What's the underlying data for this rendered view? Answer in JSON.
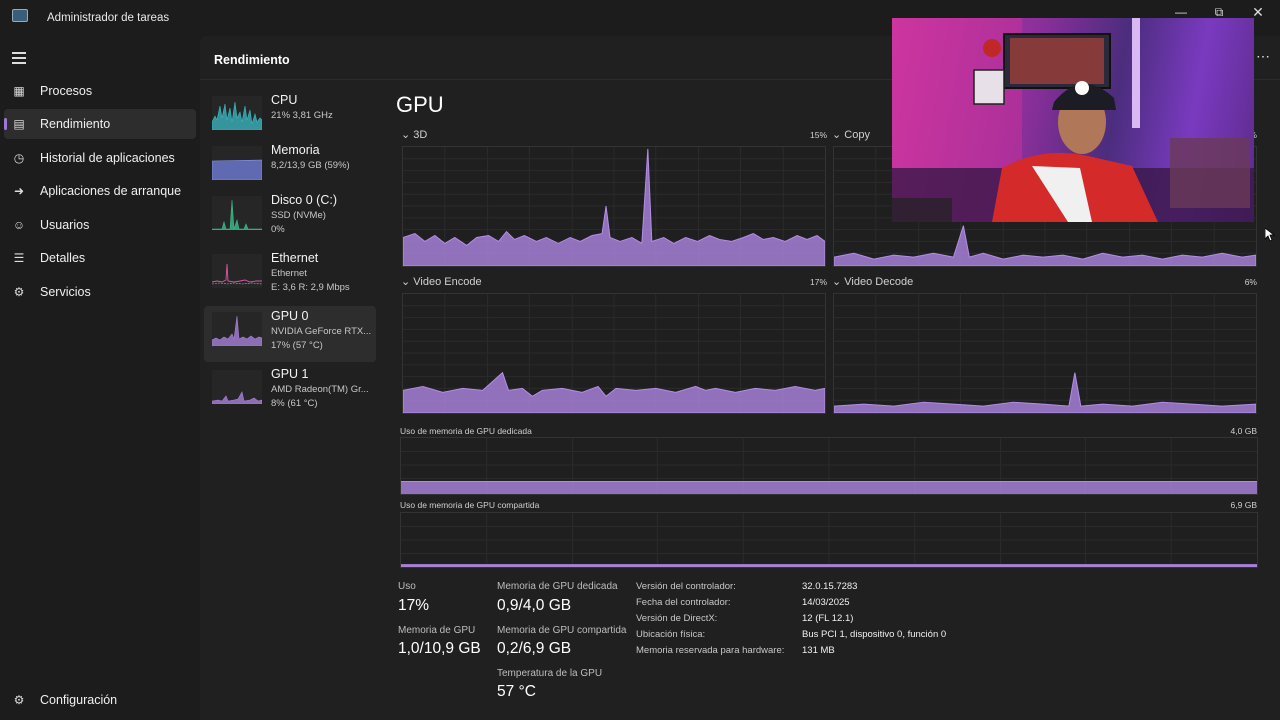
{
  "window": {
    "title": "Administrador de tareas"
  },
  "nav": {
    "items": [
      {
        "label": "Procesos",
        "icon": "processes-icon"
      },
      {
        "label": "Rendimiento",
        "icon": "performance-icon"
      },
      {
        "label": "Historial de aplicaciones",
        "icon": "history-icon"
      },
      {
        "label": "Aplicaciones de arranque",
        "icon": "startup-icon"
      },
      {
        "label": "Usuarios",
        "icon": "users-icon"
      },
      {
        "label": "Detalles",
        "icon": "details-icon"
      },
      {
        "label": "Servicios",
        "icon": "services-icon"
      }
    ],
    "settings": "Configuración"
  },
  "header": {
    "title": "Rendimiento"
  },
  "devices": [
    {
      "name": "CPU",
      "line1": "21% 3,81 GHz",
      "line2": "",
      "color": "#3bbac4"
    },
    {
      "name": "Memoria",
      "line1": "8,2/13,9 GB (59%)",
      "line2": "",
      "color": "#6e7cd6"
    },
    {
      "name": "Disco 0 (C:)",
      "line1": "SSD (NVMe)",
      "line2": "0%",
      "color": "#3bbd8a"
    },
    {
      "name": "Ethernet",
      "line1": "Ethernet",
      "line2": "E: 3,6 R: 2,9 Mbps",
      "color": "#d45aa8"
    },
    {
      "name": "GPU 0",
      "line1": "NVIDIA GeForce RTX...",
      "line2": "17% (57 °C)",
      "color": "#a780d8"
    },
    {
      "name": "GPU 1",
      "line1": "AMD Radeon(TM) Gr...",
      "line2": "8% (61 °C)",
      "color": "#a780d8"
    }
  ],
  "gpu": {
    "title": "GPU",
    "engines": [
      {
        "label": "3D",
        "percent": "15%"
      },
      {
        "label": "Copy",
        "percent": "5%"
      },
      {
        "label": "Video Encode",
        "percent": "17%"
      },
      {
        "label": "Video Decode",
        "percent": "6%"
      }
    ],
    "dedicated_label": "Uso de memoria de GPU dedicada",
    "dedicated_max": "4,0 GB",
    "shared_label": "Uso de memoria de GPU compartida",
    "shared_max": "6,9 GB",
    "stats": {
      "usage_label": "Uso",
      "usage_value": "17%",
      "gpu_mem_label": "Memoria de GPU",
      "gpu_mem_value": "1,0/10,9 GB",
      "ded_label": "Memoria de GPU dedicada",
      "ded_value": "0,9/4,0 GB",
      "shared_label": "Memoria de GPU compartida",
      "shared_value": "0,2/6,9 GB",
      "temp_label": "Temperatura de la GPU",
      "temp_value": "57 °C"
    },
    "info": [
      {
        "key": "Versión del controlador:",
        "value": "32.0.15.7283"
      },
      {
        "key": "Fecha del controlador:",
        "value": "14/03/2025"
      },
      {
        "key": "Versión de DirectX:",
        "value": "12 (FL 12.1)"
      },
      {
        "key": "Ubicación física:",
        "value": "Bus PCI 1, dispositivo 0, función 0"
      },
      {
        "key": "Memoria reservada para hardware:",
        "value": "131 MB"
      }
    ],
    "accent": "#9f78d6"
  }
}
